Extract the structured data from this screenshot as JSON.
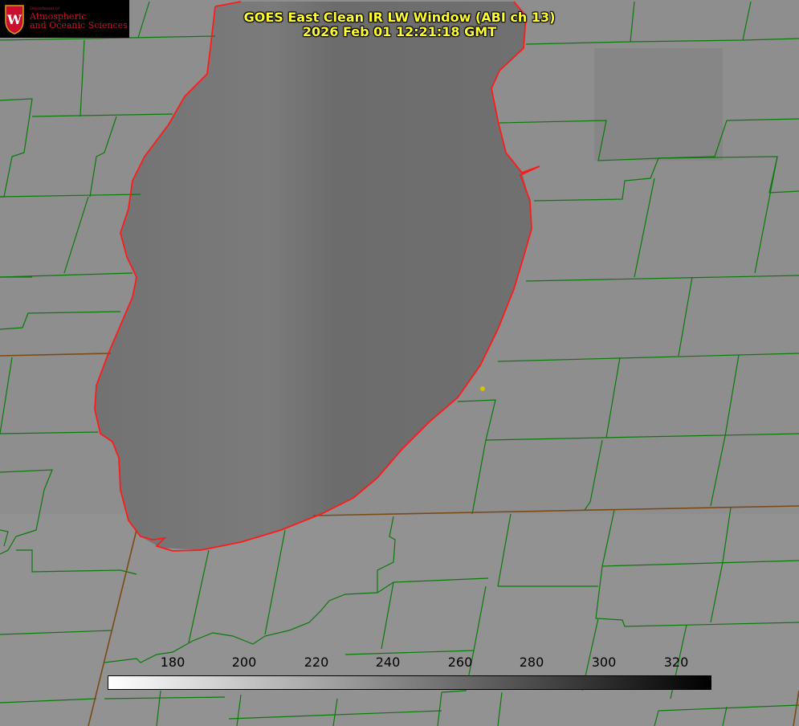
{
  "title": {
    "line1": "GOES East Clean IR LW Window (ABI ch 13)",
    "line2": "2026 Feb 01 12:21:18 GMT"
  },
  "logo": {
    "department": "Department of",
    "line1": "Atmospheric",
    "line2": "and Oceanic Sciences",
    "icon": "university-crest-icon"
  },
  "colorbar": {
    "unit": "",
    "ticks": [
      "180",
      "200",
      "220",
      "240",
      "260",
      "280",
      "300",
      "320"
    ],
    "range": [
      162,
      330
    ],
    "colors": [
      "#ffffff",
      "#000000"
    ]
  },
  "colors": {
    "land": "#8c8c8c",
    "lake": "#6f6f6f",
    "county_lines": "#0a7a0a",
    "state_lines": "#8a4a1a",
    "coastline": "#ff1a1a",
    "marker": "#d4c400",
    "title_text": "#ffff33"
  }
}
